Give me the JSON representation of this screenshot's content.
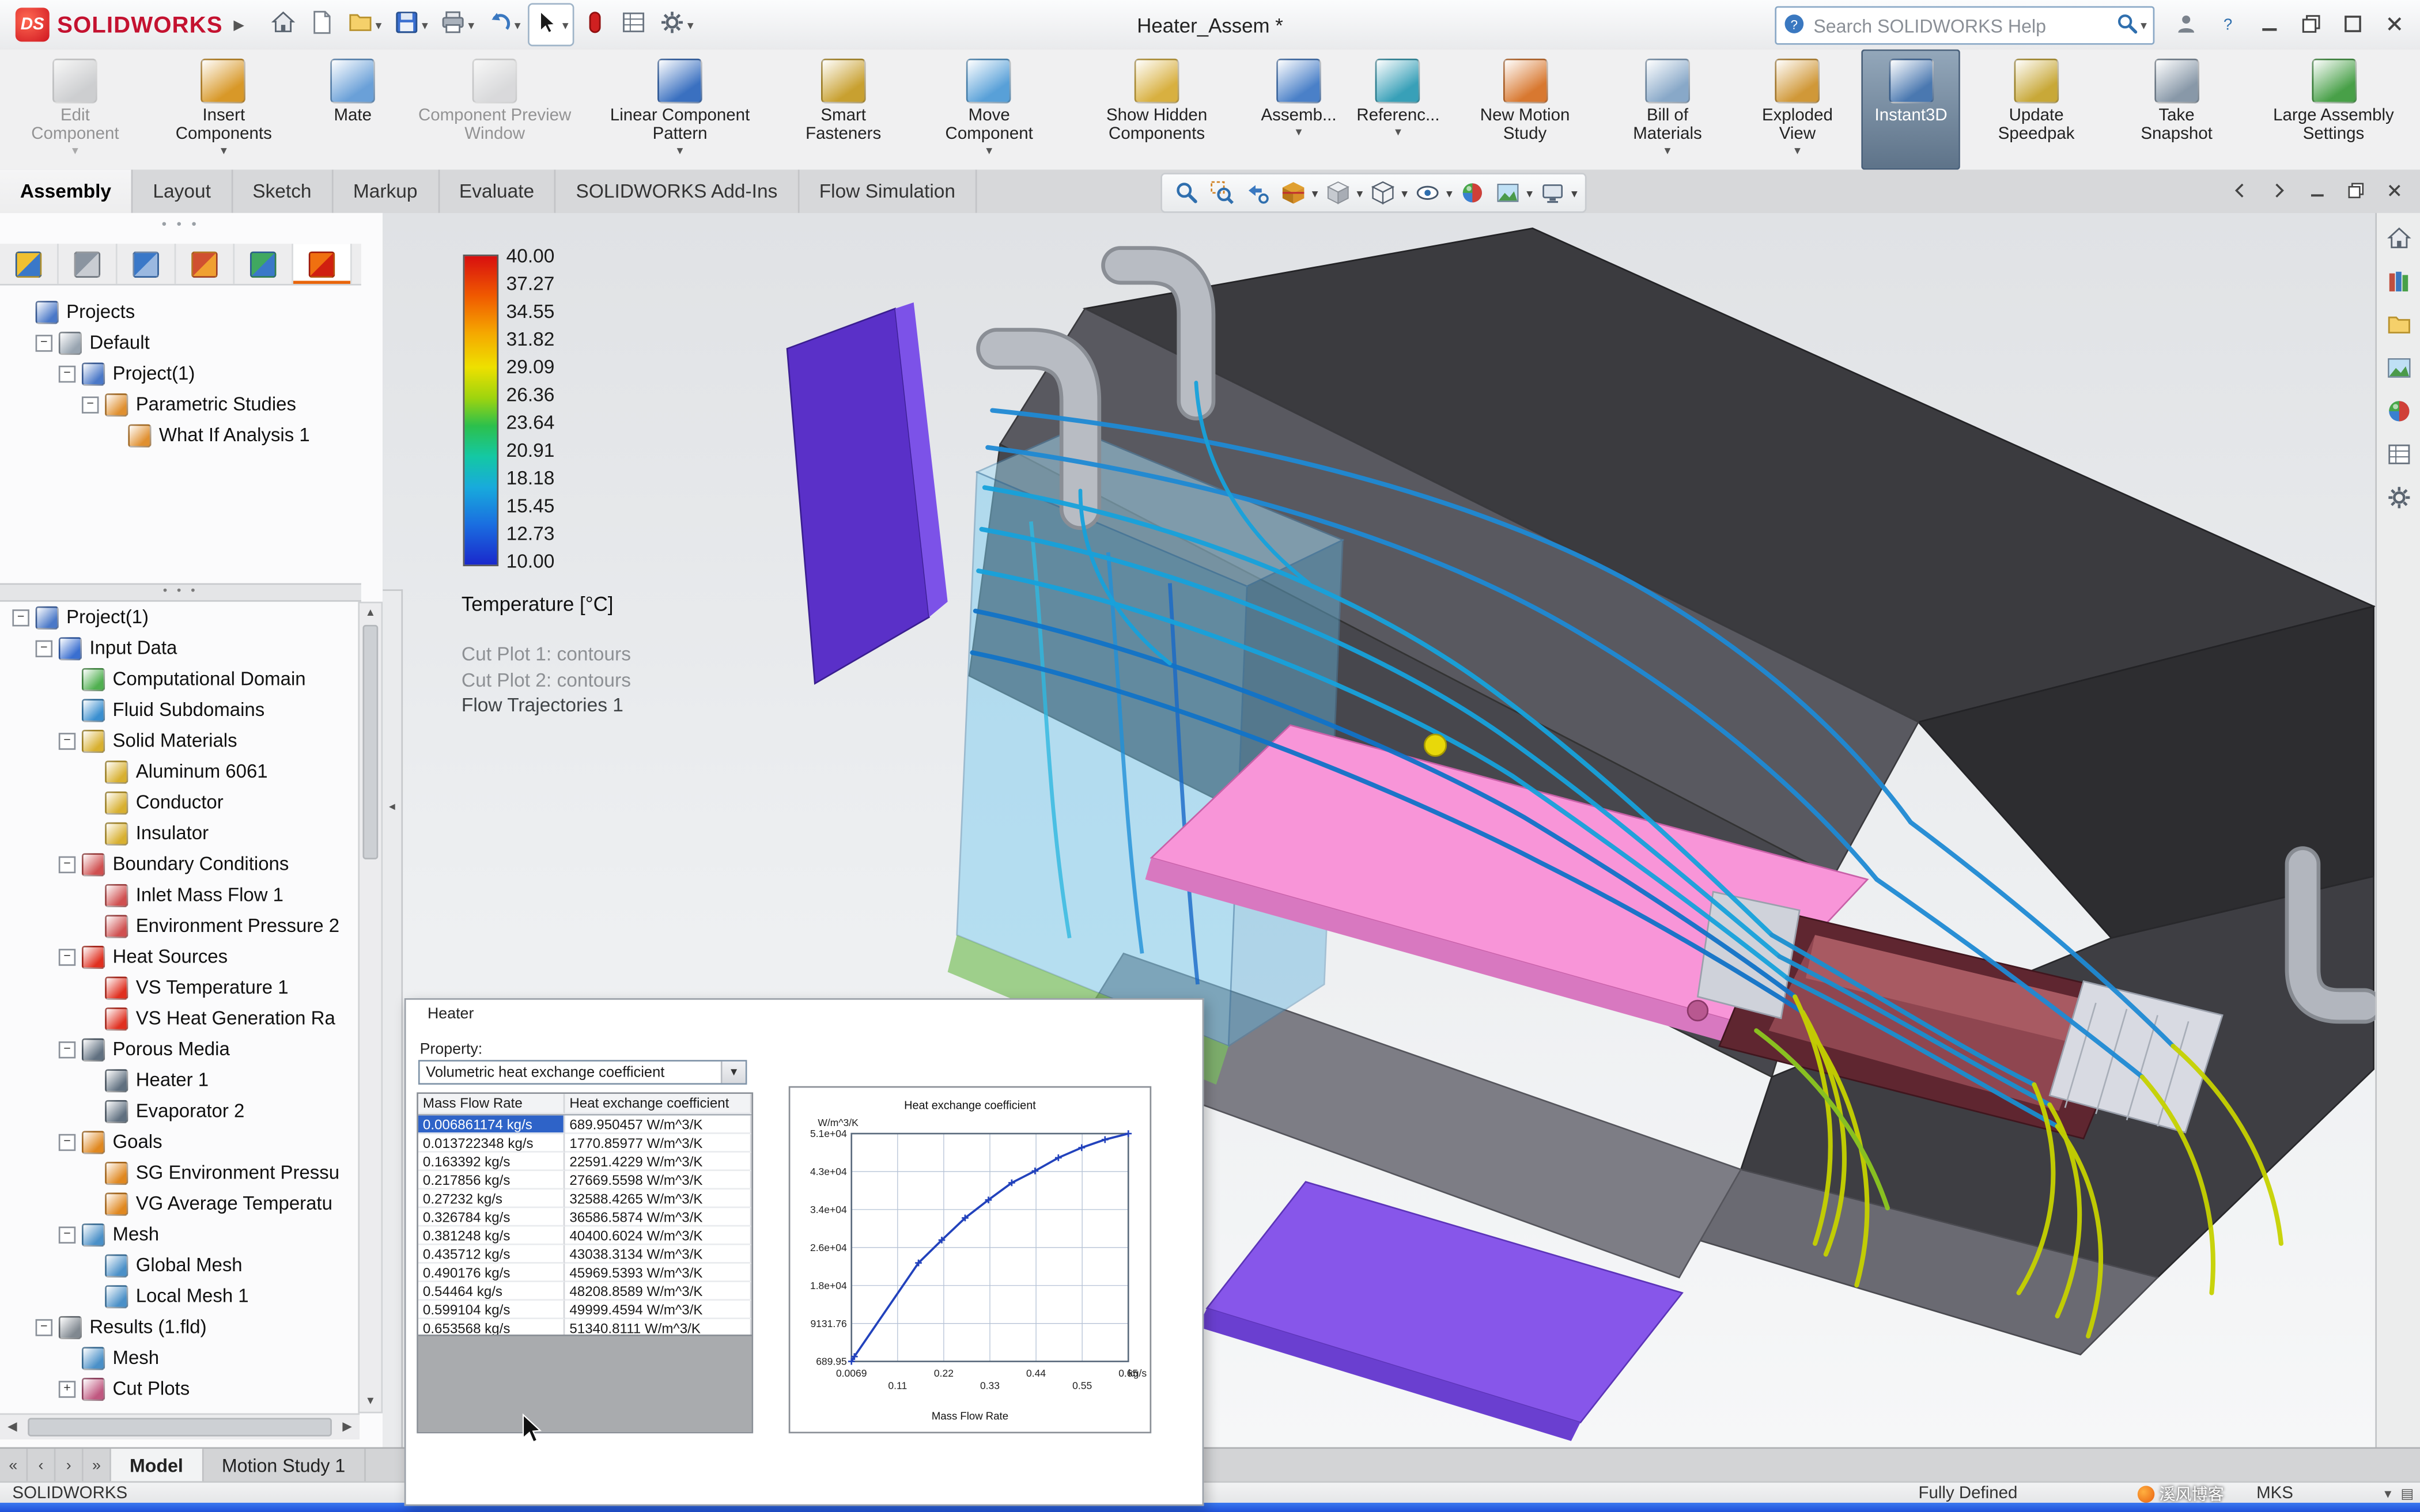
{
  "app": {
    "brand": "SOLIDWORKS",
    "document_title": "Heater_Assem *"
  },
  "titlebar": {
    "search_placeholder": "Search SOLIDWORKS Help",
    "tools": [
      {
        "name": "home-icon",
        "icon": "house"
      },
      {
        "name": "new-document-icon",
        "icon": "page"
      },
      {
        "name": "open-icon",
        "icon": "folder",
        "dropdown": true
      },
      {
        "name": "save-icon",
        "icon": "disk",
        "dropdown": true
      },
      {
        "name": "print-icon",
        "icon": "printer",
        "dropdown": true
      },
      {
        "name": "undo-icon",
        "icon": "undo",
        "dropdown": true
      },
      {
        "name": "select-icon",
        "icon": "cursorarrow",
        "dropdown": true,
        "boxed": true
      },
      {
        "name": "xpress-tools-icon",
        "icon": "reddot"
      },
      {
        "name": "design-table-icon",
        "icon": "list"
      },
      {
        "name": "options-icon",
        "icon": "gear",
        "dropdown": true
      }
    ],
    "window_buttons": [
      {
        "name": "user-icon",
        "icon": "person"
      },
      {
        "name": "help-icon",
        "icon": "question"
      },
      {
        "name": "minimize-button",
        "icon": "winmin"
      },
      {
        "name": "restore-button",
        "icon": "winrestore"
      },
      {
        "name": "maximize-button",
        "icon": "winmax"
      },
      {
        "name": "close-button",
        "icon": "winclose"
      }
    ]
  },
  "ribbon": {
    "buttons": [
      {
        "label": "Edit Component",
        "icon": "edit-component-icon",
        "color": "#9aa8b8",
        "disabled": true,
        "dropdown": true
      },
      {
        "label": "Insert Components",
        "icon": "insert-components-icon",
        "color": "#d89828",
        "dropdown": true
      },
      {
        "label": "Mate",
        "icon": "mate-icon",
        "color": "#6aa0d8"
      },
      {
        "label": "Component Preview Window",
        "icon": "component-preview-icon",
        "color": "#b8c0c8",
        "disabled": true
      },
      {
        "label": "Linear Component Pattern",
        "icon": "linear-pattern-icon",
        "color": "#3a70c0",
        "dropdown": true
      },
      {
        "label": "Smart Fasteners",
        "icon": "smart-fasteners-icon",
        "color": "#c8a030"
      },
      {
        "label": "Move Component",
        "icon": "move-component-icon",
        "color": "#58a0d8",
        "dropdown": true
      },
      {
        "label": "Show Hidden Components",
        "icon": "show-hidden-icon",
        "color": "#d8b040"
      },
      {
        "label": "Assemb...",
        "icon": "assembly-features-icon",
        "color": "#4a80c8",
        "dropdown": true
      },
      {
        "label": "Referenc...",
        "icon": "reference-geometry-icon",
        "color": "#38a0b8",
        "dropdown": true
      },
      {
        "label": "New Motion Study",
        "icon": "motion-study-icon",
        "color": "#d87830"
      },
      {
        "label": "Bill of Materials",
        "icon": "bom-icon",
        "color": "#88a8c8",
        "dropdown": true
      },
      {
        "label": "Exploded View",
        "icon": "exploded-view-icon",
        "color": "#d09838",
        "dropdown": true
      },
      {
        "label": "Instant3D",
        "icon": "instant3d-icon",
        "color": "#4a78b0",
        "active": true
      },
      {
        "label": "Update Speedpak",
        "icon": "update-speedpak-icon",
        "color": "#c8a838"
      },
      {
        "label": "Take Snapshot",
        "icon": "take-snapshot-icon",
        "color": "#8898a8"
      },
      {
        "label": "Large Assembly Settings",
        "icon": "large-assembly-icon",
        "color": "#48a048"
      }
    ]
  },
  "tabs": {
    "items": [
      "Assembly",
      "Layout",
      "Sketch",
      "Markup",
      "Evaluate",
      "SOLIDWORKS Add-Ins",
      "Flow Simulation"
    ],
    "active": "Assembly"
  },
  "headsup": [
    {
      "name": "zoom-fit-icon",
      "icon": "mag"
    },
    {
      "name": "zoom-area-icon",
      "icon": "magarea"
    },
    {
      "name": "previous-view-icon",
      "icon": "prevmag"
    },
    {
      "name": "section-view-icon",
      "icon": "section",
      "dropdown": true
    },
    {
      "name": "view-orientation-icon",
      "icon": "cube",
      "dropdown": true
    },
    {
      "name": "display-style-icon",
      "icon": "displaystyle",
      "dropdown": true
    },
    {
      "name": "hide-show-items-icon",
      "icon": "eye",
      "dropdown": true
    },
    {
      "name": "edit-appearance-icon",
      "icon": "ball"
    },
    {
      "name": "apply-scene-icon",
      "icon": "scene",
      "dropdown": true
    },
    {
      "name": "view-settings-icon",
      "icon": "monitor",
      "dropdown": true
    }
  ],
  "docwin_buttons": [
    {
      "name": "previous-window-button",
      "icon": "arrowl"
    },
    {
      "name": "next-window-button",
      "icon": "arrowr"
    },
    {
      "name": "doc-minimize-button",
      "icon": "winmin"
    },
    {
      "name": "doc-restore-button",
      "icon": "winrestore"
    },
    {
      "name": "doc-close-button",
      "icon": "winclose"
    }
  ],
  "left_panel": {
    "tab_icons": [
      {
        "name": "featuremanager-tab",
        "c1": "#f0c030",
        "c2": "#3a78c8"
      },
      {
        "name": "propertymanager-tab",
        "c1": "#8a94a0",
        "c2": "#c8ccd2"
      },
      {
        "name": "configurationmanager-tab",
        "c1": "#3a78c8",
        "c2": "#9ab8e0"
      },
      {
        "name": "dimxpertmanager-tab",
        "c1": "#d05030",
        "c2": "#f0a030"
      },
      {
        "name": "displaymanager-tab",
        "c1": "#40a860",
        "c2": "#3a78c8"
      },
      {
        "name": "flow-simulation-tab",
        "c1": "#f07010",
        "c2": "#d02010",
        "active": true
      }
    ],
    "analysis_tree": [
      {
        "label": "Projects",
        "indent": 0,
        "exp": "",
        "color": "#4a78c8"
      },
      {
        "label": "Default",
        "indent": 1,
        "exp": "minus",
        "color": "#98a4b0"
      },
      {
        "label": "Project(1)",
        "indent": 2,
        "exp": "minus",
        "color": "#4a78c8"
      },
      {
        "label": "Parametric Studies",
        "indent": 3,
        "exp": "minus",
        "color": "#e09030"
      },
      {
        "label": "What If Analysis 1",
        "indent": 4,
        "exp": "",
        "color": "#e09030"
      }
    ],
    "project_tree": [
      {
        "label": "Project(1)",
        "indent": 0,
        "exp": "minus",
        "color": "#4a78c8"
      },
      {
        "label": "Input Data",
        "indent": 1,
        "exp": "minus",
        "color": "#3a6fd0"
      },
      {
        "label": "Computational Domain",
        "indent": 2,
        "exp": "",
        "color": "#50b050"
      },
      {
        "label": "Fluid Subdomains",
        "indent": 2,
        "exp": "",
        "color": "#3a8fd0"
      },
      {
        "label": "Solid Materials",
        "indent": 2,
        "exp": "minus",
        "color": "#d8b030"
      },
      {
        "label": "Aluminum 6061",
        "indent": 3,
        "exp": "",
        "color": "#d8b030"
      },
      {
        "label": "Conductor",
        "indent": 3,
        "exp": "",
        "color": "#d8b030"
      },
      {
        "label": "Insulator",
        "indent": 3,
        "exp": "",
        "color": "#d8b030"
      },
      {
        "label": "Boundary Conditions",
        "indent": 2,
        "exp": "minus",
        "color": "#d05050"
      },
      {
        "label": "Inlet Mass Flow 1",
        "indent": 3,
        "exp": "",
        "color": "#d05050"
      },
      {
        "label": "Environment Pressure 2",
        "indent": 3,
        "exp": "",
        "color": "#d05050"
      },
      {
        "label": "Heat Sources",
        "indent": 2,
        "exp": "minus",
        "color": "#e03020"
      },
      {
        "label": "VS Temperature 1",
        "indent": 3,
        "exp": "",
        "color": "#e03020"
      },
      {
        "label": "VS Heat Generation Ra",
        "indent": 3,
        "exp": "",
        "color": "#e03020"
      },
      {
        "label": "Porous Media",
        "indent": 2,
        "exp": "minus",
        "color": "#607080"
      },
      {
        "label": "Heater 1",
        "indent": 3,
        "exp": "",
        "color": "#607080"
      },
      {
        "label": "Evaporator 2",
        "indent": 3,
        "exp": "",
        "color": "#607080"
      },
      {
        "label": "Goals",
        "indent": 2,
        "exp": "minus",
        "color": "#e08820"
      },
      {
        "label": "SG Environment Pressu",
        "indent": 3,
        "exp": "",
        "color": "#e08820"
      },
      {
        "label": "VG Average Temperatu",
        "indent": 3,
        "exp": "",
        "color": "#e08820"
      },
      {
        "label": "Mesh",
        "indent": 2,
        "exp": "minus",
        "color": "#4a90c8"
      },
      {
        "label": "Global Mesh",
        "indent": 3,
        "exp": "",
        "color": "#4a90c8"
      },
      {
        "label": "Local Mesh 1",
        "indent": 3,
        "exp": "",
        "color": "#4a90c8"
      },
      {
        "label": "Results (1.fld)",
        "indent": 1,
        "exp": "minus",
        "color": "#808890"
      },
      {
        "label": "Mesh",
        "indent": 2,
        "exp": "",
        "color": "#4a90c8"
      },
      {
        "label": "Cut Plots",
        "indent": 2,
        "exp": "plus",
        "color": "#c05880"
      }
    ]
  },
  "viewport": {
    "legend": {
      "ticks": [
        "40.00",
        "37.27",
        "34.55",
        "31.82",
        "29.09",
        "26.36",
        "23.64",
        "20.91",
        "18.18",
        "15.45",
        "12.73",
        "10.00"
      ],
      "title": "Temperature [°C]",
      "annotations": [
        "Cut Plot 1: contours",
        "Cut Plot 2: contours",
        "Flow Trajectories 1"
      ]
    }
  },
  "taskpane": [
    {
      "name": "home-icon",
      "icon": "house"
    },
    {
      "name": "design-library-icon",
      "icon": "books"
    },
    {
      "name": "file-explorer-icon",
      "icon": "folder"
    },
    {
      "name": "view-palette-icon",
      "icon": "scene"
    },
    {
      "name": "appearances-icon",
      "icon": "ball"
    },
    {
      "name": "custom-properties-icon",
      "icon": "list"
    },
    {
      "name": "resources-icon",
      "icon": "gear"
    }
  ],
  "heater_dialog": {
    "title": "Heater",
    "property_label": "Property:",
    "property_value": "Volumetric heat exchange coefficient",
    "table": {
      "columns": [
        "Mass Flow Rate",
        "Heat exchange coefficient"
      ],
      "selected_row": 0,
      "rows": [
        [
          "0.006861174 kg/s",
          "689.950457 W/m^3/K"
        ],
        [
          "0.013722348 kg/s",
          "1770.85977 W/m^3/K"
        ],
        [
          "0.163392 kg/s",
          "22591.4229 W/m^3/K"
        ],
        [
          "0.217856 kg/s",
          "27669.5598 W/m^3/K"
        ],
        [
          "0.27232 kg/s",
          "32588.4265 W/m^3/K"
        ],
        [
          "0.326784 kg/s",
          "36586.5874 W/m^3/K"
        ],
        [
          "0.381248 kg/s",
          "40400.6024 W/m^3/K"
        ],
        [
          "0.435712 kg/s",
          "43038.3134 W/m^3/K"
        ],
        [
          "0.490176 kg/s",
          "45969.5393 W/m^3/K"
        ],
        [
          "0.54464 kg/s",
          "48208.8589 W/m^3/K"
        ],
        [
          "0.599104 kg/s",
          "49999.4594 W/m^3/K"
        ],
        [
          "0.653568 kg/s",
          "51340.8111 W/m^3/K"
        ]
      ]
    }
  },
  "chart_data": {
    "type": "line",
    "title": "Heat exchange coefficient",
    "y_unit": "W/m^3/K",
    "x_unit": "kg/s",
    "xlabel": "Mass Flow Rate",
    "x": [
      0.006861174,
      0.013722348,
      0.163392,
      0.217856,
      0.27232,
      0.326784,
      0.381248,
      0.435712,
      0.490176,
      0.54464,
      0.599104,
      0.653568
    ],
    "y": [
      689.950457,
      1770.85977,
      22591.4229,
      27669.5598,
      32588.4265,
      36586.5874,
      40400.6024,
      43038.3134,
      45969.5393,
      48208.8589,
      49999.4594,
      51340.8111
    ],
    "y_ticks": [
      "5.1e+04",
      "4.3e+04",
      "3.4e+04",
      "2.6e+04",
      "1.8e+04",
      "9131.76",
      "689.95"
    ],
    "x_ticks": [
      "0.0069",
      "0.11",
      "0.22",
      "0.33",
      "0.44",
      "0.55",
      "0.65"
    ],
    "xlim": [
      0.006861174,
      0.653568
    ],
    "ylim": [
      689.950457,
      51340.8111
    ],
    "grid": true,
    "legend_position": "none"
  },
  "bottom": {
    "vcr": [
      "«",
      "‹",
      "›",
      "»"
    ],
    "tabs": [
      "Model",
      "Motion Study 1"
    ],
    "active": "Model"
  },
  "statusbar": {
    "left": "SOLIDWORKS",
    "status": "Fully Defined",
    "units": "MKS",
    "watermark": "溪风博客"
  }
}
